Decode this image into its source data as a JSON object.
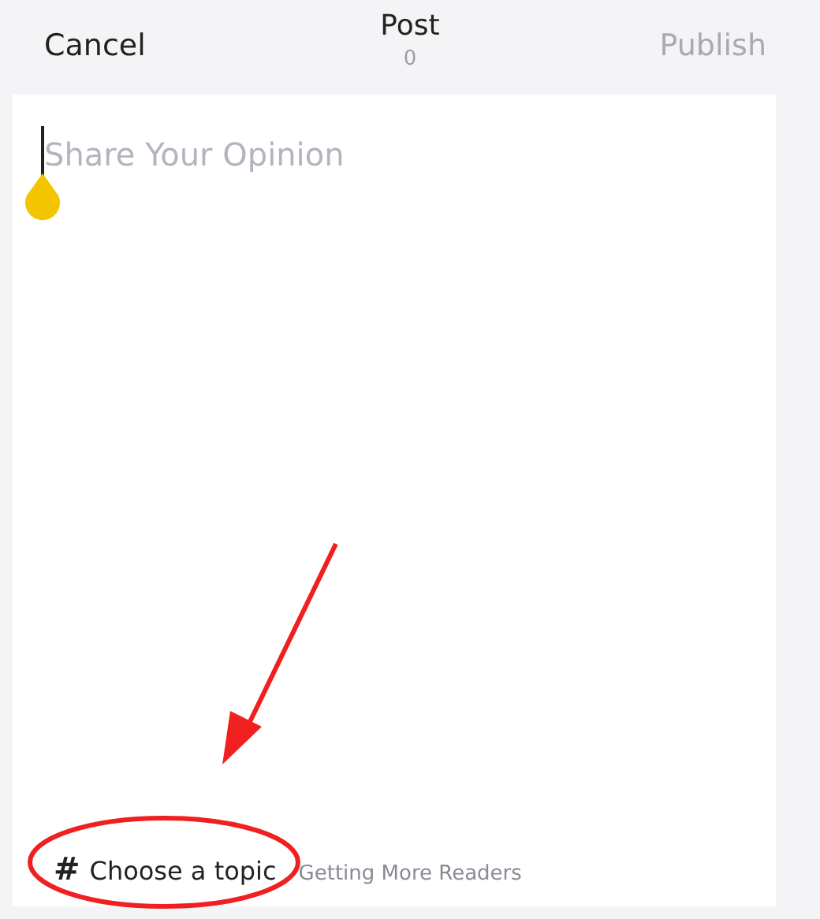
{
  "header": {
    "cancel": "Cancel",
    "title": "Post",
    "count": "0",
    "publish": "Publish",
    "publish_disabled": true
  },
  "editor": {
    "placeholder": "Share Your Opinion"
  },
  "footer": {
    "topic_icon": "#",
    "topic": "Choose a topic",
    "hint": "Getting More Readers"
  }
}
